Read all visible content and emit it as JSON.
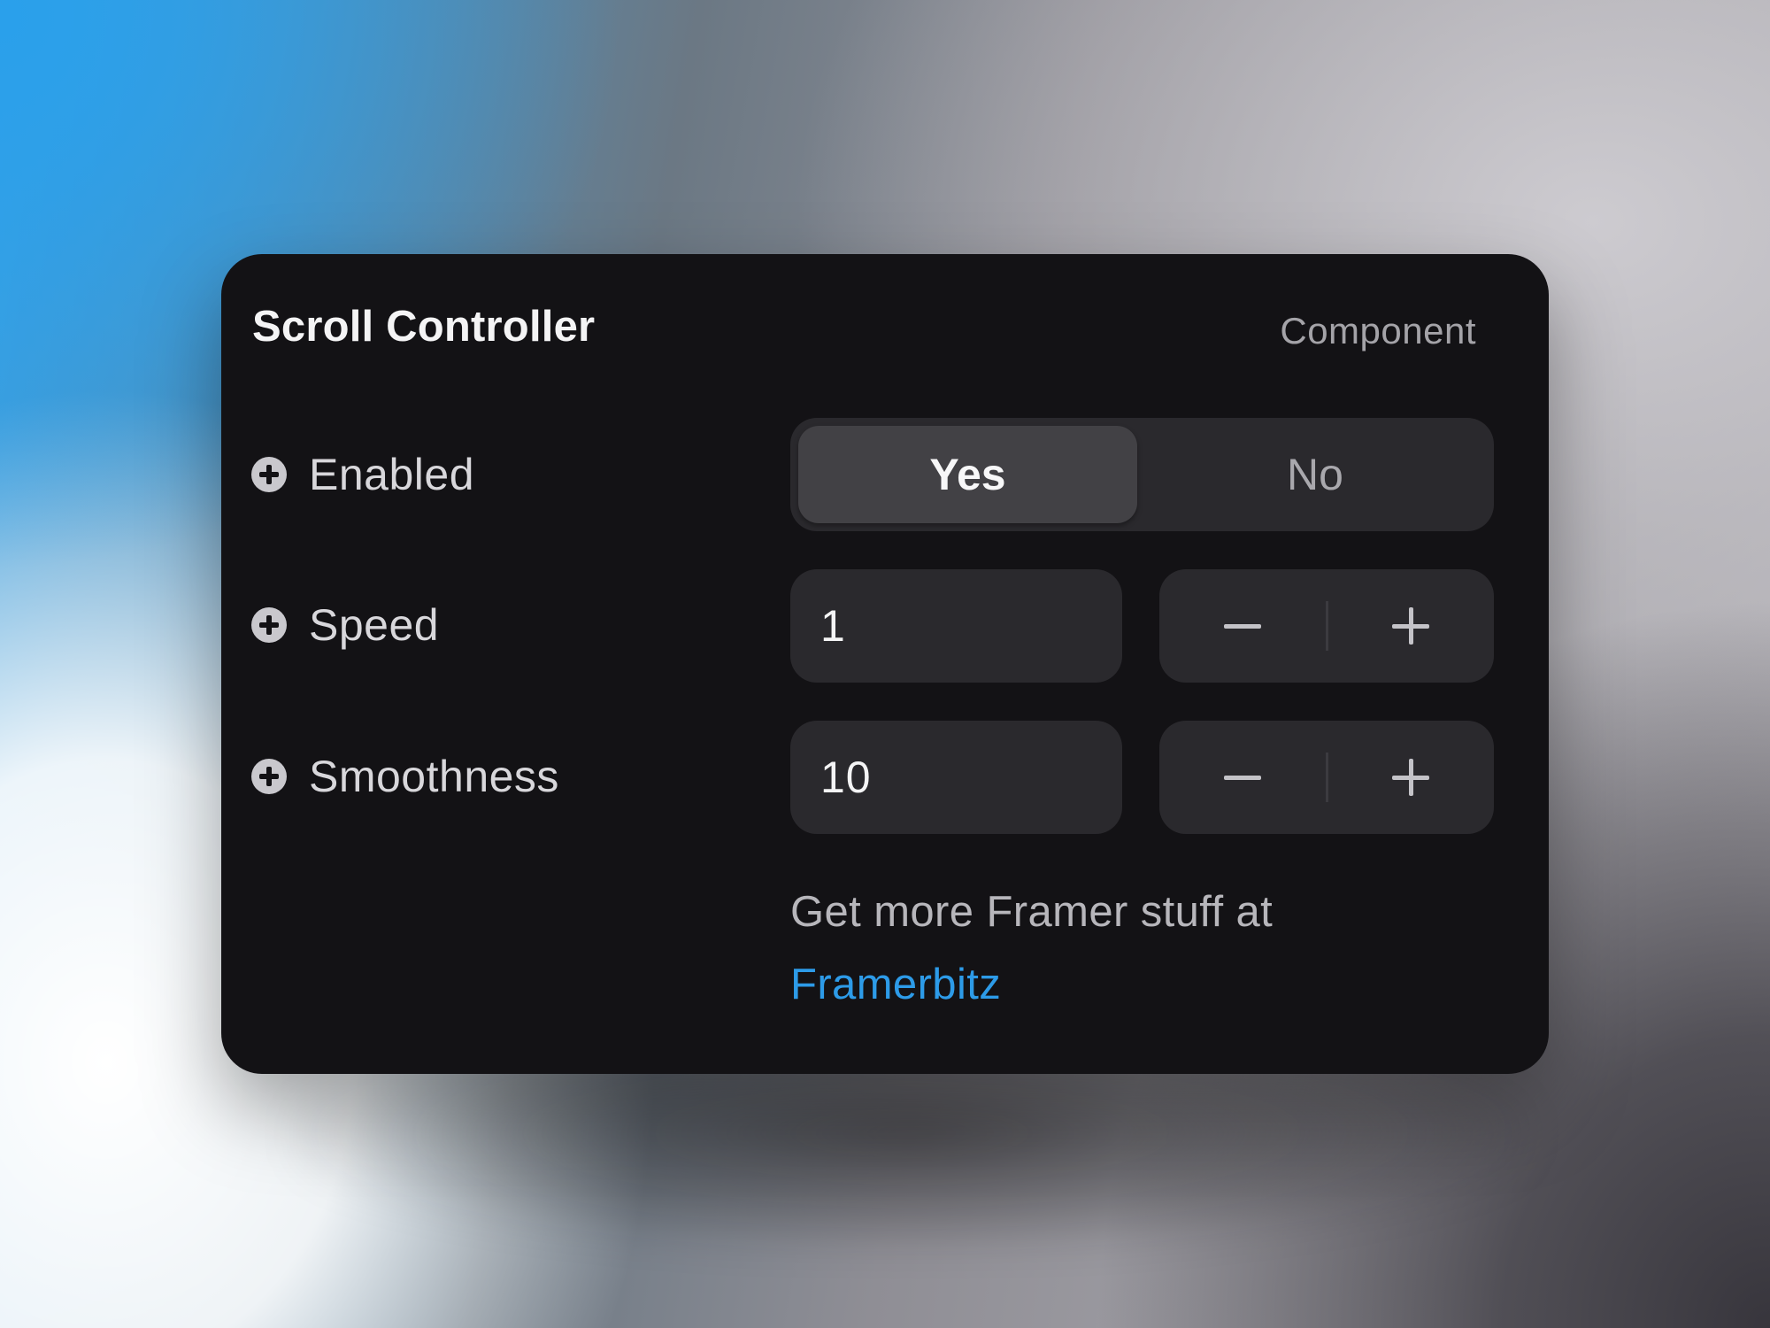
{
  "panel": {
    "title": "Scroll Controller",
    "tag": "Component"
  },
  "controls": {
    "enabled": {
      "label": "Enabled",
      "options": [
        "Yes",
        "No"
      ],
      "selected": "Yes"
    },
    "speed": {
      "label": "Speed",
      "value": "1"
    },
    "smoothness": {
      "label": "Smoothness",
      "value": "10"
    }
  },
  "footer": {
    "text": "Get more Framer stuff at",
    "link_text": "Framerbitz"
  },
  "colors": {
    "panel_bg": "#131215",
    "control_bg": "#2a292d",
    "selected_segment": "#424145",
    "link": "#2d9be8"
  },
  "icons": {
    "row_icon": "plus-circle-icon",
    "decrement": "minus-icon",
    "increment": "plus-icon"
  }
}
